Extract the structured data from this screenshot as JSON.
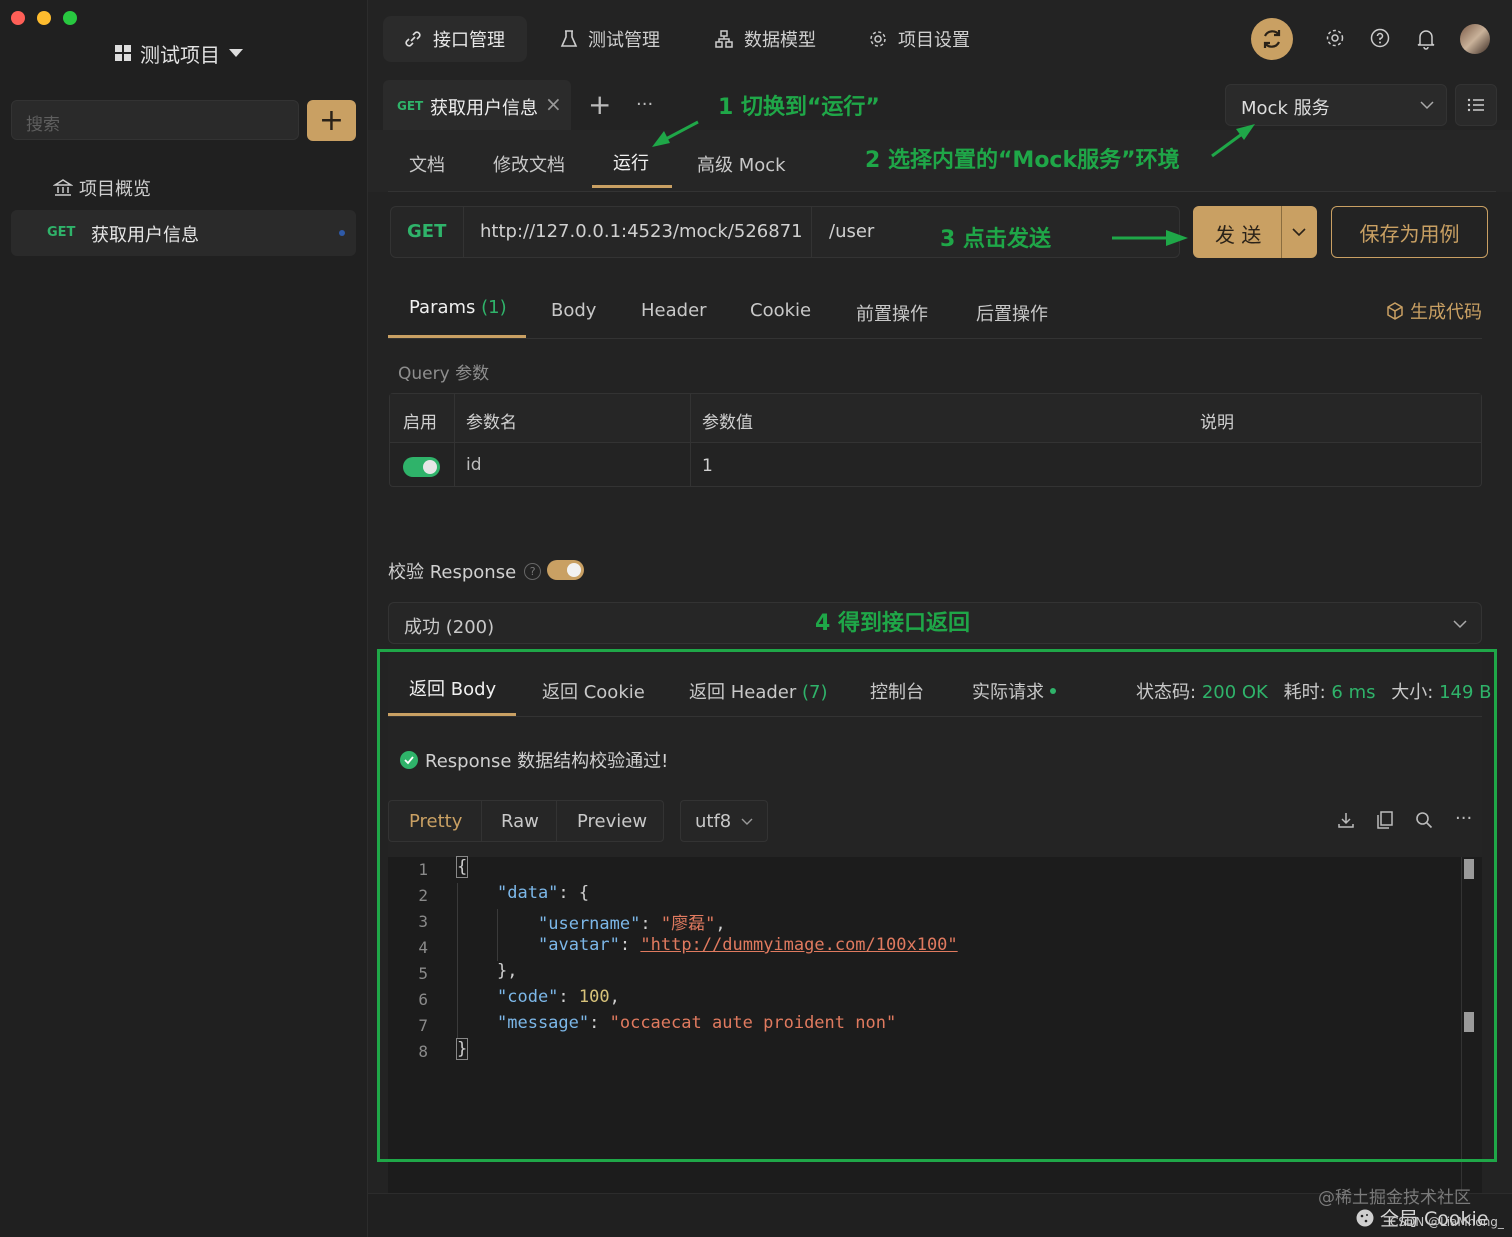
{
  "sidebar": {
    "project_title": "测试项目",
    "search_placeholder": "搜索",
    "add_label": "+",
    "items": [
      {
        "label": "项目概览"
      },
      {
        "method": "GET",
        "label": "获取用户信息"
      }
    ]
  },
  "topnav": {
    "tabs": [
      {
        "label": "接口管理"
      },
      {
        "label": "测试管理"
      },
      {
        "label": "数据模型"
      },
      {
        "label": "项目设置"
      }
    ]
  },
  "request_tab": {
    "method": "GET",
    "title": "获取用户信息",
    "close": "×",
    "add": "+",
    "more": "···"
  },
  "env_select": {
    "value": "Mock 服务"
  },
  "subtabs": [
    {
      "label": "文档"
    },
    {
      "label": "修改文档"
    },
    {
      "label": "运行"
    },
    {
      "label": "高级 Mock"
    }
  ],
  "annotations": {
    "step1": "1 切换到“运行”",
    "step2": "2 选择内置的“Mock服务”环境",
    "step3": "3 点击发送",
    "step4": "4 得到接口返回"
  },
  "url_bar": {
    "method": "GET",
    "base": "http://127.0.0.1:4523/mock/526871",
    "path": "/user",
    "send": "发 送",
    "save": "保存为用例"
  },
  "param_tabs": [
    {
      "label": "Params",
      "count": "(1)"
    },
    {
      "label": "Body"
    },
    {
      "label": "Header"
    },
    {
      "label": "Cookie"
    },
    {
      "label": "前置操作"
    },
    {
      "label": "后置操作"
    }
  ],
  "generate_code": "生成代码",
  "query": {
    "title": "Query 参数",
    "headers": [
      "启用",
      "参数名",
      "参数值",
      "说明"
    ],
    "rows": [
      {
        "name": "id",
        "value": "1",
        "desc": ""
      }
    ]
  },
  "validate": {
    "label": "校验 Response",
    "help": "?"
  },
  "response_select": {
    "value": "成功 (200)"
  },
  "response_tabs": [
    {
      "label": "返回 Body"
    },
    {
      "label": "返回 Cookie"
    },
    {
      "label": "返回 Header",
      "count": "(7)"
    },
    {
      "label": "控制台"
    },
    {
      "label": "实际请求"
    }
  ],
  "status": {
    "code_label": "状态码:",
    "code": "200 OK",
    "time_label": "耗时:",
    "time": "6 ms",
    "size_label": "大小:",
    "size": "149 B"
  },
  "validation_msg": "Response 数据结构校验通过!",
  "format_tabs": [
    {
      "label": "Pretty"
    },
    {
      "label": "Raw"
    },
    {
      "label": "Preview"
    }
  ],
  "encoding": "utf8",
  "code": {
    "line_numbers": [
      "1",
      "2",
      "3",
      "4",
      "5",
      "6",
      "7",
      "8"
    ],
    "open": "{",
    "data_key": "\"data\"",
    "username_key": "\"username\"",
    "username_val": "\"廖磊\"",
    "avatar_key": "\"avatar\"",
    "avatar_val": "\"http://dummyimage.com/100x100\"",
    "code_key": "\"code\"",
    "code_val": "100",
    "message_key": "\"message\"",
    "message_val": "\"occaecat aute proident non\"",
    "close": "}"
  },
  "watermark": {
    "line1": "@稀土掘金技术社区",
    "line2": "全局 Cookie",
    "line3": "CSDN @LiaMhong_"
  },
  "colors": {
    "accent": "#c9a063",
    "green": "#2fb36a",
    "annotation": "#1fa748"
  }
}
